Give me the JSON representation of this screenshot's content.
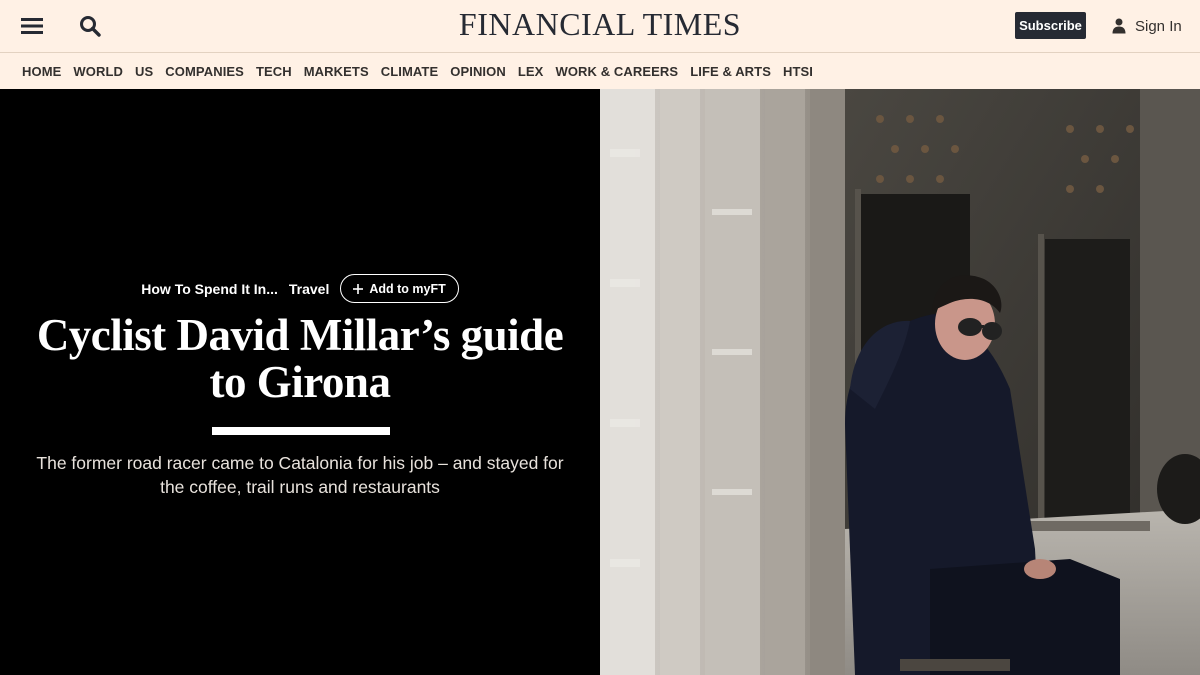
{
  "header": {
    "brand": "FINANCIAL TIMES",
    "subscribe_label": "Subscribe",
    "signin_label": "Sign In",
    "icons": {
      "menu": "hamburger-menu-icon",
      "search": "search-icon",
      "user": "user-icon"
    }
  },
  "nav": {
    "items": [
      {
        "label": "HOME"
      },
      {
        "label": "WORLD"
      },
      {
        "label": "US"
      },
      {
        "label": "COMPANIES"
      },
      {
        "label": "TECH"
      },
      {
        "label": "MARKETS"
      },
      {
        "label": "CLIMATE"
      },
      {
        "label": "OPINION"
      },
      {
        "label": "LEX"
      },
      {
        "label": "WORK & CAREERS"
      },
      {
        "label": "LIFE & ARTS"
      },
      {
        "label": "HTSI"
      }
    ]
  },
  "article": {
    "section_tag": "How To Spend It In...",
    "topic_tag": "Travel",
    "myft_label": "Add to myFT",
    "headline": "Cyclist David Millar’s guide to Girona",
    "standfirst": "The former road racer came to Catalonia for his job – and stayed for the coffee, trail runs and restaurants"
  },
  "colors": {
    "page_bg": "#fff1e5",
    "hero_bg": "#000000",
    "subscribe_bg": "#262a33",
    "text_dark": "#33302e"
  }
}
